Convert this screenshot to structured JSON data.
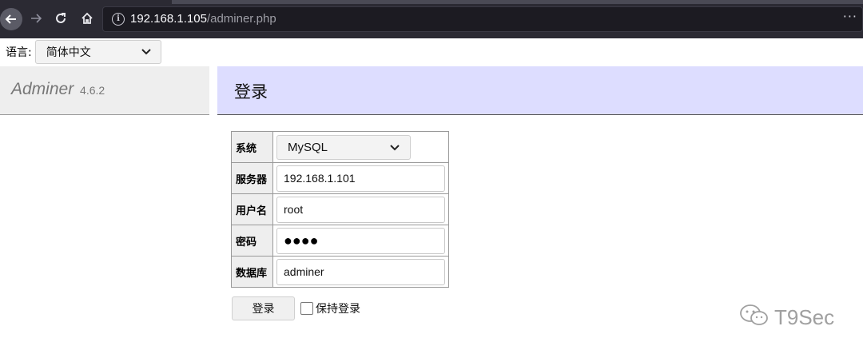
{
  "browser": {
    "url_host": "192.168.1.105",
    "url_path": "/adminer.php",
    "more_icon": "···"
  },
  "language": {
    "label": "语言:",
    "selected": "简体中文"
  },
  "sidebar": {
    "brand": "Adminer",
    "version": "4.6.2"
  },
  "main": {
    "title": "登录"
  },
  "login_form": {
    "system_label": "系统",
    "system_value": "MySQL",
    "server_label": "服务器",
    "server_value": "192.168.1.101",
    "username_label": "用户名",
    "username_value": "root",
    "password_label": "密码",
    "password_value": "●●●●",
    "database_label": "数据库",
    "database_value": "adminer",
    "submit_label": "登录",
    "remember_label": "保持登录"
  },
  "watermark": {
    "text": "T9Sec"
  }
}
